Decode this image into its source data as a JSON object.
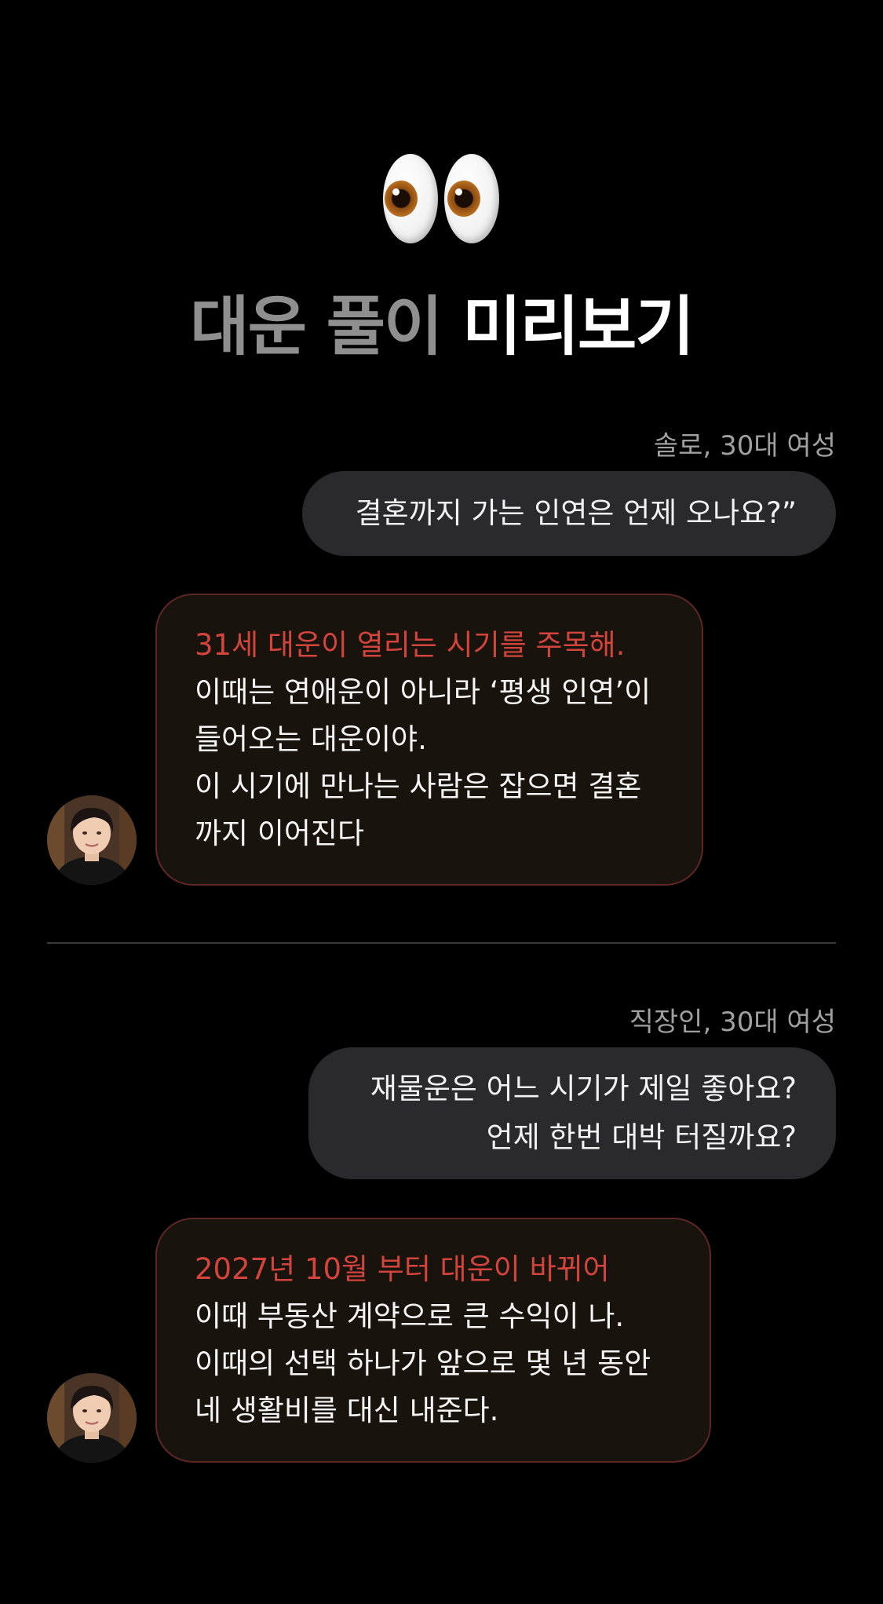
{
  "header": {
    "title_part1": "대운 풀이",
    "title_part2": "미리보기",
    "emoji_icon": "eyes-emoji-icon"
  },
  "conversations": [
    {
      "tag": "솔로, 30대 여성",
      "question_lines": [
        "결혼까지 가는 인연은 언제 오나요?”"
      ],
      "answer_highlight": "31세 대운이 열리는 시기를 주목해.",
      "answer_lines": [
        "이때는 연애운이 아니라 ‘평생 인연’이",
        "들어오는 대운이야.",
        "이 시기에 만나는 사람은 잡으면 결혼",
        "까지 이어진다"
      ]
    },
    {
      "tag": "직장인, 30대 여성",
      "question_lines": [
        "재물운은 어느 시기가 제일 좋아요?",
        "언제 한번 대박 터질까요?"
      ],
      "answer_highlight": "2027년 10월 부터 대운이 바뀌어",
      "answer_lines": [
        "이때 부동산 계약으로 큰 수익이 나.",
        "이때의 선택 하나가 앞으로 몇 년 동안",
        "네 생활비를 대신 내준다."
      ]
    }
  ],
  "colors": {
    "background": "#000000",
    "title_muted": "#8f8f8f",
    "question_bubble": "#2a2a2c",
    "answer_bubble": "#19130d",
    "answer_border": "#5e2624",
    "highlight": "#d2443c"
  }
}
